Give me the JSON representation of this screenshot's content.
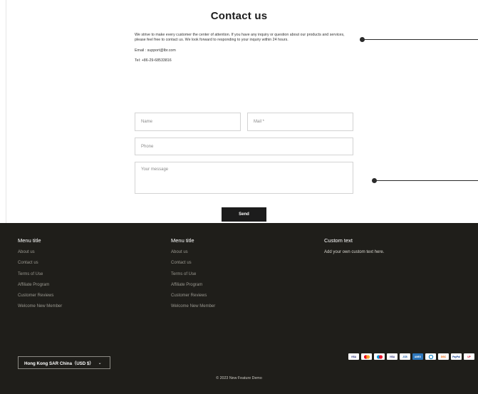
{
  "page": {
    "title": "Contact us",
    "intro": "We strive to make every customer the center of attention. If you have any inquiry or question about our products and services, please feel free to contact us. We look forward to responding to your inquiry within 24 hours.",
    "email": "Email : support@lbr.com",
    "tel": "Tel: +86-29-68533816"
  },
  "form": {
    "name_placeholder": "Name",
    "mail_placeholder": "Mail *",
    "phone_placeholder": "Phone",
    "message_placeholder": "Your message",
    "send_label": "Send"
  },
  "footer": {
    "col1": {
      "title": "Menu title",
      "links": [
        "About us",
        "Contact us",
        "Terms of Use",
        "Affiliate Program",
        "Customer Reviews",
        "Welcome New Member"
      ]
    },
    "col2": {
      "title": "Menu title",
      "links": [
        "About us",
        "Contact us",
        "Terms of Use",
        "Affiliate Program",
        "Customer Reviews",
        "Welcome New Member"
      ]
    },
    "col3": {
      "title": "Custom text",
      "text": "Add your own custom text here."
    },
    "region_label": "Hong Kong SAR China（USD $）",
    "payment_icons": [
      "visa-icon",
      "mastercard-icon",
      "maestro-icon",
      "visa-electron-icon",
      "jcb-icon",
      "amex-icon",
      "diners-icon",
      "discover-icon",
      "paypal-icon",
      "unionpay-icon"
    ],
    "payment_labels": [
      "VISA",
      "",
      "",
      "VISA",
      "JCB",
      "AMEX",
      "",
      "DISC",
      "PayPal",
      "UP"
    ],
    "copyright": "© 2023 New Feature Demo"
  },
  "colors": {
    "footer_bg": "#1f1e1a",
    "button_bg": "#1c1c1c",
    "accent": "#2b2b2b"
  }
}
